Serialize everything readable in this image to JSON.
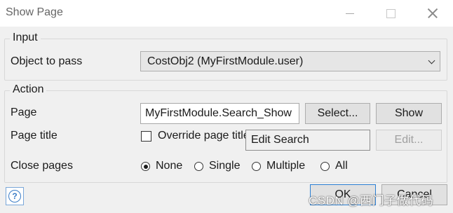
{
  "window": {
    "title": "Show Page",
    "minimize_icon": "minimize-icon",
    "maximize_icon": "maximize-icon",
    "close_icon": "close-icon"
  },
  "input_group": {
    "legend": "Input",
    "object_label": "Object to pass",
    "object_value": "CostObj2 (MyFirstModule.user)"
  },
  "action_group": {
    "legend": "Action",
    "page_label": "Page",
    "page_value": "MyFirstModule.Search_Show",
    "select_button": "Select...",
    "show_button": "Show",
    "page_title_label": "Page title",
    "override_label": "Override page title",
    "override_checked": false,
    "tooltip_text": "Edit Search",
    "edit_button": "Edit...",
    "close_pages_label": "Close pages",
    "close_options": [
      "None",
      "Single",
      "Multiple",
      "All"
    ],
    "close_selected": "None"
  },
  "footer": {
    "help_icon": "help-icon",
    "ok_button": "OK",
    "cancel_button": "Cancel",
    "watermark": "CSDN @西门子做代码"
  }
}
